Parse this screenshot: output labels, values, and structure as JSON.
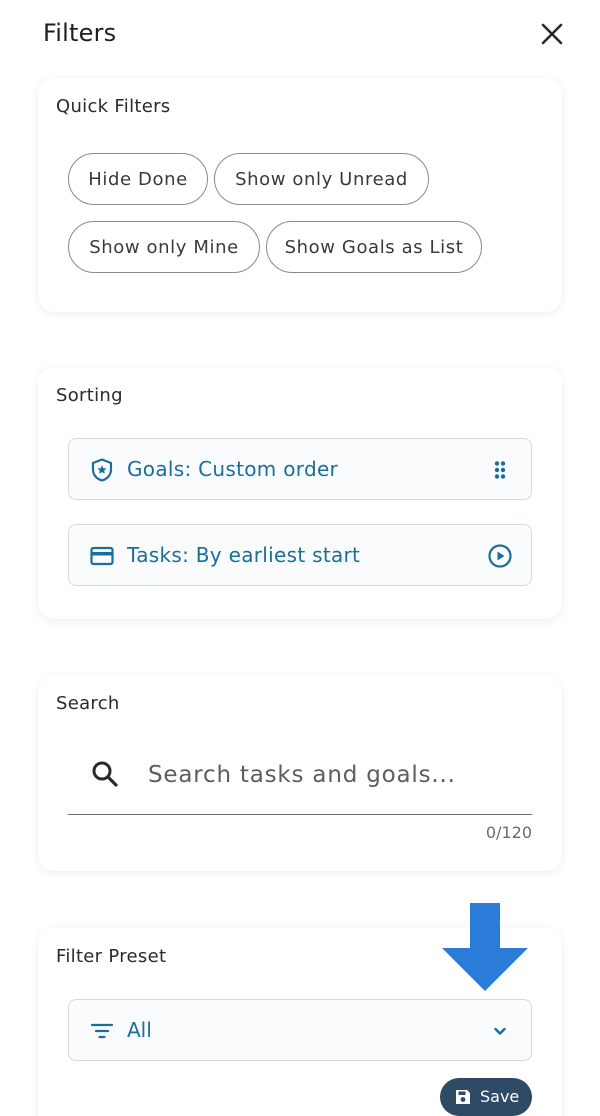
{
  "header": {
    "title": "Filters",
    "close_icon": "close-icon"
  },
  "quick_filters": {
    "title": "Quick Filters",
    "chips": [
      "Hide Done",
      "Show only Unread",
      "Show only Mine",
      "Show Goals as List"
    ]
  },
  "sorting": {
    "title": "Sorting",
    "goals": {
      "label": "Goals: Custom order",
      "icon": "shield-star-icon",
      "trailing_icon": "drag-handle-icon"
    },
    "tasks": {
      "label": "Tasks: By earliest start",
      "icon": "card-icon",
      "trailing_icon": "play-circle-icon"
    }
  },
  "search": {
    "title": "Search",
    "placeholder": "Search tasks and goals...",
    "value": "",
    "counter": "0/120"
  },
  "filter_preset": {
    "title": "Filter Preset",
    "selected": "All",
    "save_label": "Save"
  },
  "colors": {
    "accent": "#1a6f9a",
    "save_button": "#2e4a64",
    "arrow": "#2b7bd8"
  }
}
